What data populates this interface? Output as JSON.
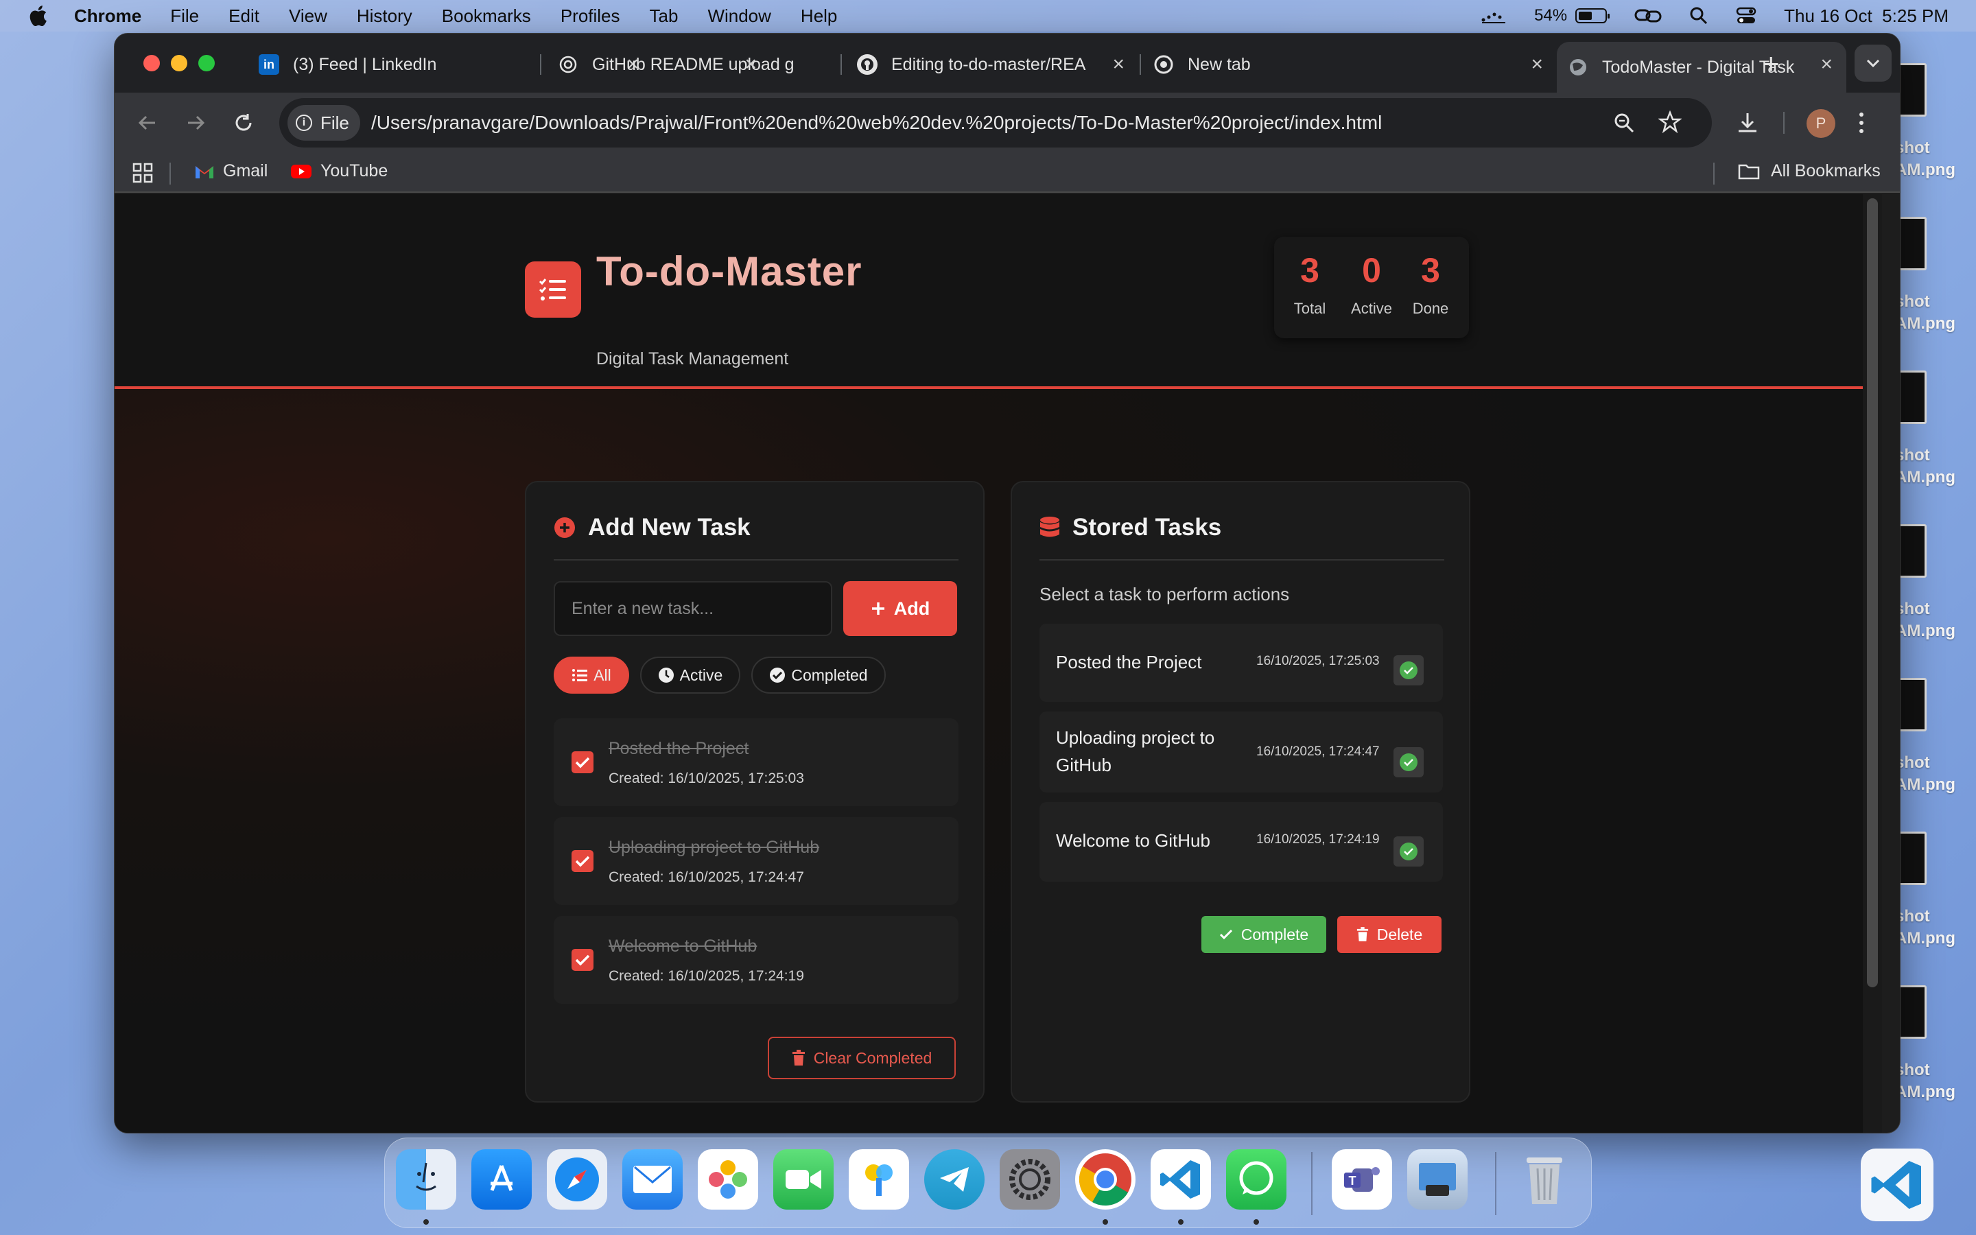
{
  "menubar": {
    "app": "Chrome",
    "items": [
      "File",
      "Edit",
      "View",
      "History",
      "Bookmarks",
      "Profiles",
      "Tab",
      "Window",
      "Help"
    ],
    "battery_percent": "54%",
    "battery_level": 0.54,
    "datetime": "Thu 16 Oct  5:25 PM"
  },
  "desktop": {
    "files": [
      {
        "line1": "shot",
        "line2": "AM.png"
      },
      {
        "line1": "shot",
        "line2": "AM.png"
      },
      {
        "line1": "shot",
        "line2": "AM.png"
      },
      {
        "line1": "shot",
        "line2": "AM.png"
      },
      {
        "line1": "shot",
        "line2": "AM.png"
      },
      {
        "line1": "shot",
        "line2": "AM.png"
      },
      {
        "line1": "shot",
        "line2": "AM.png"
      }
    ]
  },
  "browser": {
    "tabs": [
      {
        "title": "(3) Feed | LinkedIn",
        "icon": "linkedin-icon"
      },
      {
        "title": "GitHub README upload g",
        "icon": "openai-icon"
      },
      {
        "title": "Editing to-do-master/REA",
        "icon": "github-icon"
      },
      {
        "title": "New tab",
        "icon": "chrome-icon"
      },
      {
        "title": "TodoMaster - Digital Task",
        "icon": "globe-icon"
      }
    ],
    "url_chip": "File",
    "url": "/Users/pranavgare/Downloads/Prajwal/Front%20end%20web%20dev.%20projects/To-Do-Master%20project/index.html",
    "profile_initial": "P",
    "bookmarks": [
      "Gmail",
      "YouTube"
    ],
    "all_bookmarks": "All Bookmarks"
  },
  "app": {
    "title": "To-do-Master",
    "subtitle": "Digital Task Management",
    "stats": [
      {
        "value": "3",
        "label": "Total"
      },
      {
        "value": "0",
        "label": "Active"
      },
      {
        "value": "3",
        "label": "Done"
      }
    ],
    "add_panel": {
      "title": "Add New Task",
      "input_placeholder": "Enter a new task...",
      "add_label": "Add",
      "filters": [
        "All",
        "Active",
        "Completed"
      ],
      "active_filter": "All",
      "tasks": [
        {
          "name": "Posted the Project",
          "created": "Created: 16/10/2025, 17:25:03",
          "done": true
        },
        {
          "name": "Uploading project to GitHub",
          "created": "Created: 16/10/2025, 17:24:47",
          "done": true
        },
        {
          "name": "Welcome to GitHub",
          "created": "Created: 16/10/2025, 17:24:19",
          "done": true
        }
      ],
      "clear_label": "Clear Completed"
    },
    "stored_panel": {
      "title": "Stored Tasks",
      "hint": "Select a task to perform actions",
      "tasks": [
        {
          "name": "Posted the Project",
          "date": "16/10/2025, 17:25:03"
        },
        {
          "name_line1": "Uploading project to",
          "name_line2": "GitHub",
          "date": "16/10/2025, 17:24:47"
        },
        {
          "name": "Welcome to GitHub",
          "date": "16/10/2025, 17:24:19"
        }
      ],
      "complete_label": "Complete",
      "delete_label": "Delete"
    },
    "colors": {
      "accent": "#e5473d",
      "success": "#4caf50",
      "background": "#111111"
    }
  },
  "dock": {
    "apps": [
      "Finder",
      "App Store",
      "Safari",
      "Mail",
      "Photos",
      "FaceTime",
      "Passwords",
      "Telegram",
      "System Settings",
      "Chrome",
      "VS Code",
      "WhatsApp",
      "Teams",
      "Preview",
      "Trash"
    ]
  }
}
